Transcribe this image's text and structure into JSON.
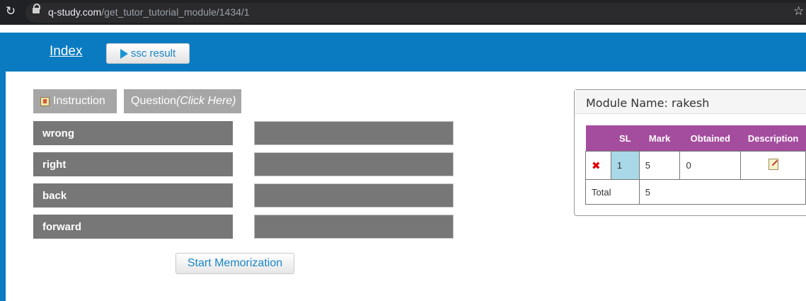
{
  "browser": {
    "url_domain": "q-study.com",
    "url_path": "/get_tutor_tutorial_module/1434/1"
  },
  "nav": {
    "index_label": "Index",
    "ssc_result_label": "ssc result"
  },
  "tabs": {
    "instruction_label": "Instruction",
    "question_label": "Question",
    "question_hint": "(Click Here)"
  },
  "words": [
    "wrong",
    "right",
    "back",
    "forward"
  ],
  "answers": [
    "",
    "",
    "",
    ""
  ],
  "start_button_label": "Start Memorization",
  "module": {
    "title": "Module Name: rakesh",
    "columns": [
      "SL",
      "Mark",
      "Obtained",
      "Description"
    ],
    "row": {
      "status_icon": "x-icon",
      "sl": "1",
      "mark": "5",
      "obtained": "0",
      "description_icon": "edit-icon"
    },
    "total_label": "Total",
    "total_value": "5"
  },
  "colors": {
    "header_blue": "#0a7bc1",
    "table_header_purple": "#a44d9e",
    "word_box_gray": "#777777",
    "tab_gray": "#a6a6a6",
    "sl_cell_blue": "#a9d8e8"
  }
}
